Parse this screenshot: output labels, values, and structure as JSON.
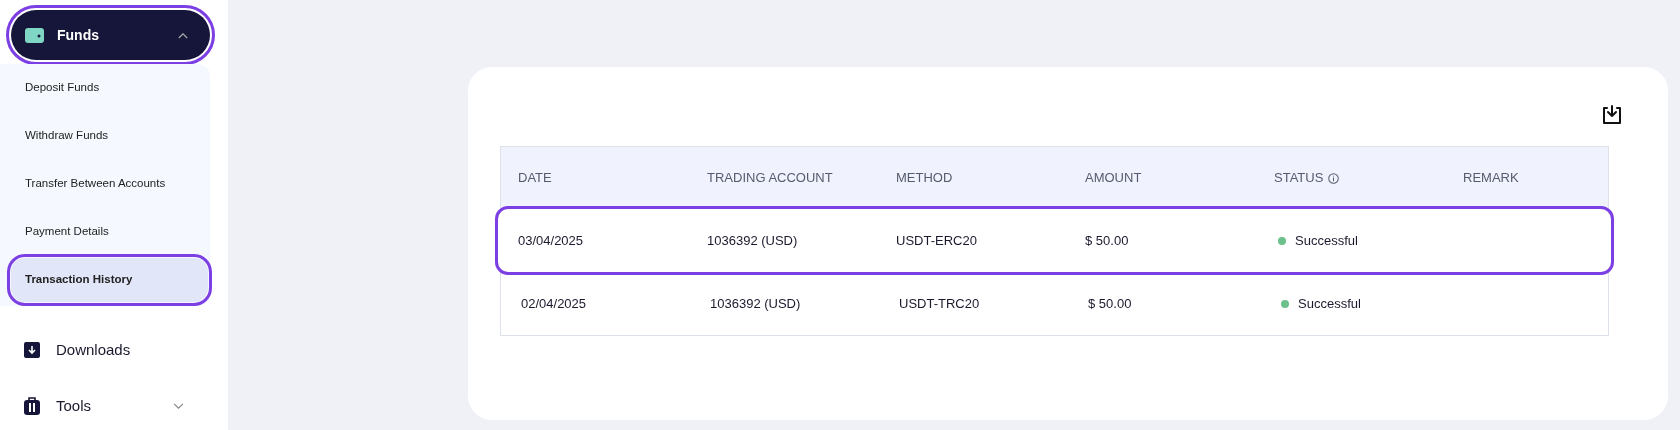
{
  "sidebar": {
    "funds": {
      "label": "Funds",
      "expanded": true,
      "highlighted": true
    },
    "sub_items": [
      {
        "label": "Deposit Funds",
        "selected": false,
        "highlighted": false
      },
      {
        "label": "Withdraw Funds",
        "selected": false,
        "highlighted": false
      },
      {
        "label": "Transfer Between Accounts",
        "selected": false,
        "highlighted": false
      },
      {
        "label": "Payment Details",
        "selected": false,
        "highlighted": false
      },
      {
        "label": "Transaction History",
        "selected": true,
        "highlighted": true
      }
    ],
    "items": [
      {
        "kind": "downloads",
        "label": "Downloads"
      },
      {
        "kind": "tools",
        "label": "Tools",
        "expanded": false
      }
    ]
  },
  "table": {
    "columns": [
      "DATE",
      "TRADING ACCOUNT",
      "METHOD",
      "AMOUNT",
      "STATUS",
      "REMARK"
    ],
    "rows": [
      {
        "cells": [
          "03/04/2025",
          "1036392 (USD)",
          "USDT-ERC20",
          "$ 50.00"
        ],
        "status": "Successful",
        "color": "#6cc08b",
        "highlighted": true
      },
      {
        "cells": [
          "02/04/2025",
          "1036392 (USD)",
          "USDT-TRC20",
          "$ 50.00"
        ],
        "status": "Successful",
        "color": "#6cc08b",
        "highlighted": false
      }
    ]
  }
}
